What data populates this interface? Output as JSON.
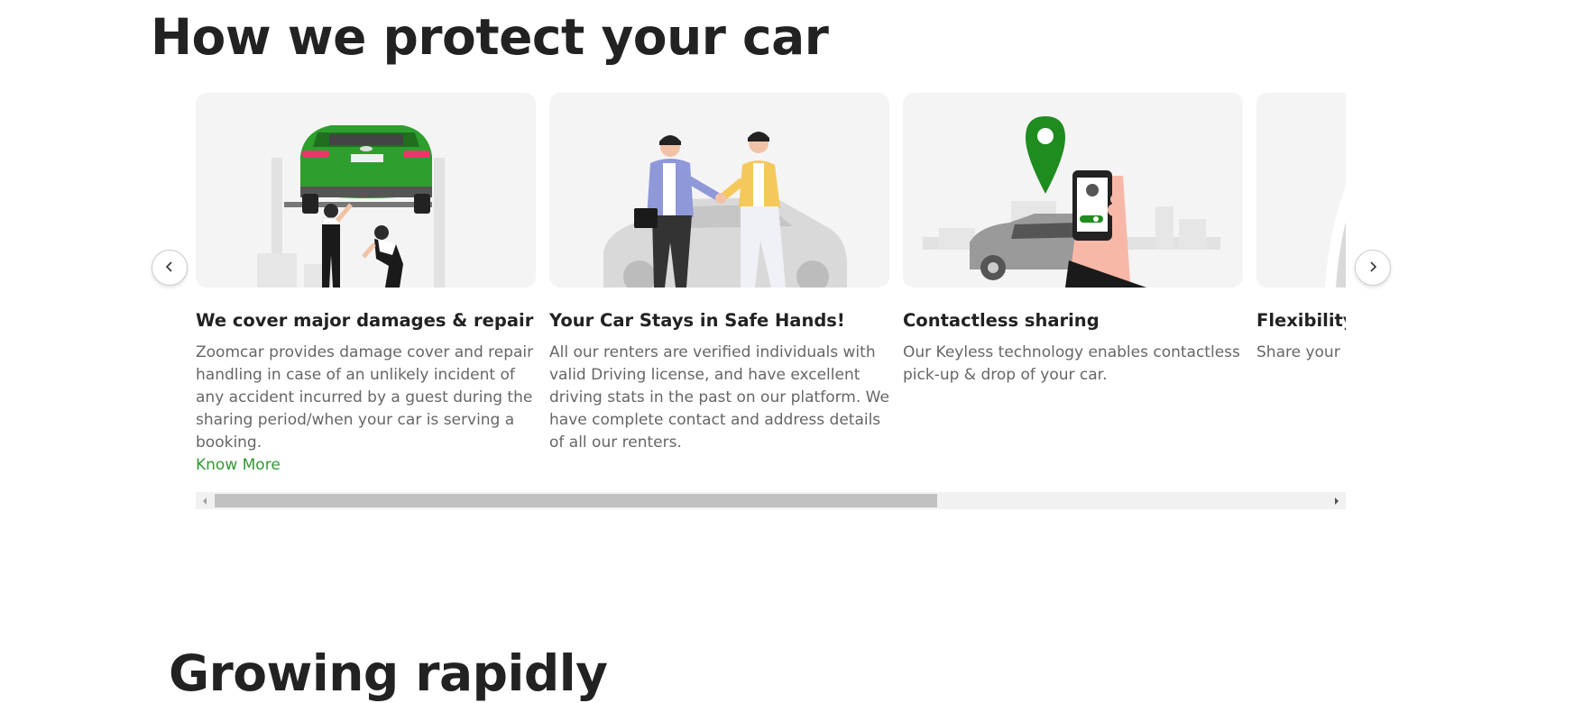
{
  "section": {
    "title": "How we protect your car"
  },
  "cards": [
    {
      "title": "We cover major damages & repair",
      "description": "Zoomcar provides damage cover and repair handling in case of an unlikely incident of any accident incurred by a guest during the sharing period/when your car is serving a booking.",
      "link": "Know More",
      "image": "car-repair-illustration"
    },
    {
      "title": "Your Car Stays in Safe Hands!",
      "description": "All our renters are verified individuals with valid Driving license, and have excellent driving stats in the past on our platform. We have complete contact and address details of all our renters.",
      "image": "handshake-illustration"
    },
    {
      "title": "Contactless sharing",
      "description": "Our Keyless technology enables contactless pick-up & drop of your car.",
      "image": "keyless-phone-illustration"
    },
    {
      "title": "Flexibility",
      "description": "Share your c your usage a",
      "image": "flexibility-illustration"
    }
  ],
  "next_section": {
    "title": "Growing rapidly"
  },
  "colors": {
    "accent": "#339933",
    "car_green": "#2e9e2e",
    "card_bg": "#f4f4f4"
  },
  "icons": {
    "prev": "chevron-left-icon",
    "next": "chevron-right-icon"
  },
  "scroll_position": 0.63
}
